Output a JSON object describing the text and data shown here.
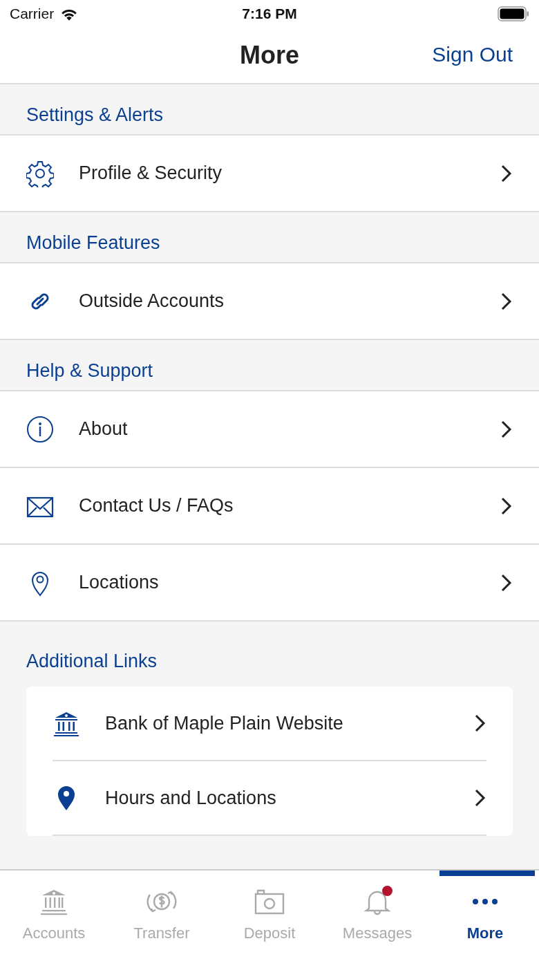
{
  "status_bar": {
    "carrier": "Carrier",
    "time": "7:16 PM"
  },
  "nav_bar": {
    "title": "More",
    "action": "Sign Out"
  },
  "sections": [
    {
      "header": "Settings & Alerts",
      "items": [
        {
          "label": "Profile & Security"
        }
      ]
    },
    {
      "header": "Mobile Features",
      "items": [
        {
          "label": "Outside Accounts"
        }
      ]
    },
    {
      "header": "Help & Support",
      "items": [
        {
          "label": "About"
        },
        {
          "label": "Contact Us / FAQs"
        },
        {
          "label": "Locations"
        }
      ]
    }
  ],
  "additional_links": {
    "header": "Additional Links",
    "items": [
      {
        "label": "Bank of Maple Plain Website"
      },
      {
        "label": "Hours and Locations"
      }
    ]
  },
  "tab_bar": [
    {
      "label": "Accounts",
      "selected": false,
      "badge": false
    },
    {
      "label": "Transfer",
      "selected": false,
      "badge": false
    },
    {
      "label": "Deposit",
      "selected": false,
      "badge": false
    },
    {
      "label": "Messages",
      "selected": false,
      "badge": true
    },
    {
      "label": "More",
      "selected": true,
      "badge": false
    }
  ]
}
